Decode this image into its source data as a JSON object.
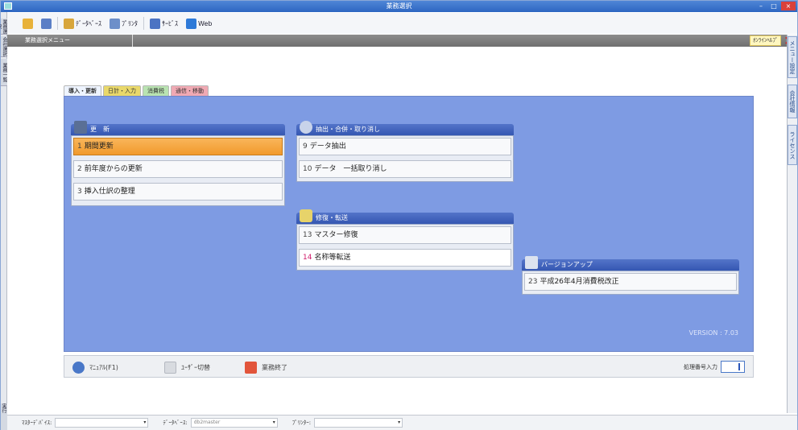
{
  "window": {
    "title": "業務選択",
    "controls": [
      "–",
      "□",
      "×"
    ]
  },
  "toolbar": {
    "buttons": [
      {
        "label": "",
        "icon": "folder-icon"
      },
      {
        "label": "",
        "icon": "tree-icon"
      },
      {
        "label": "ﾃﾞｰﾀﾍﾞｰｽ",
        "icon": "database-icon"
      },
      {
        "label": "ﾌﾟﾘﾝﾀ",
        "icon": "printer-icon"
      },
      {
        "label": "ｻｰﾋﾞｽ",
        "icon": "monitor-icon"
      },
      {
        "label": "Web",
        "icon": "web-icon"
      }
    ]
  },
  "header": {
    "label": "業務選択メニュー",
    "help_badge": "ｵﾝﾗｲﾝﾍﾙﾌﾟ",
    "close": "×"
  },
  "left_rail": [
    "業務選択",
    "会社選択",
    "業務一覧"
  ],
  "right_rail": [
    "メニュー設定",
    "会社情報",
    "ライセンス"
  ],
  "tabs": [
    {
      "label": "導入・更新"
    },
    {
      "label": "日計・入力"
    },
    {
      "label": "消費税"
    },
    {
      "label": "通信・移動"
    }
  ],
  "groups": {
    "update": {
      "title": "更　新",
      "items": [
        {
          "num": "1",
          "label": "期間更新"
        },
        {
          "num": "2",
          "label": "前年度からの更新"
        },
        {
          "num": "3",
          "label": "挿入仕訳の整理"
        }
      ]
    },
    "extract": {
      "title": "抽出・合併・取り消し",
      "items": [
        {
          "num": "9",
          "label": "データ抽出"
        },
        {
          "num": "10",
          "label": "データ　一括取り消し"
        }
      ]
    },
    "repair": {
      "title": "修復・転送",
      "items": [
        {
          "num": "13",
          "label": "マスター修復"
        },
        {
          "num": "14",
          "label": "名称等転送"
        }
      ]
    },
    "version": {
      "title": "バージョンアップ",
      "items": [
        {
          "num": "23",
          "label": "平成26年4月消費税改正"
        }
      ]
    }
  },
  "version_text": "VERSION : 7.03",
  "footer": {
    "manual": "ﾏﾆｭｱﾙ(F1)",
    "user_switch": "ﾕｰｻﾞｰ切替",
    "exit": "業務終了",
    "number_input_label": "処理番号入力"
  },
  "statusbar": {
    "master_device_label": "ﾏｽﾀｰﾃﾞﾊﾞｲｽ:",
    "database_label": "ﾃﾞｰﾀﾍﾞｰｽ:",
    "database_value": "db2master",
    "printer_label": "ﾌﾟﾘﾝﾀｰ:"
  },
  "colors": {
    "panel": "#7e9be3",
    "active_item": "#f19a2c",
    "title_bar": "#2d66c2",
    "header_bar": "#6f6f6f"
  }
}
